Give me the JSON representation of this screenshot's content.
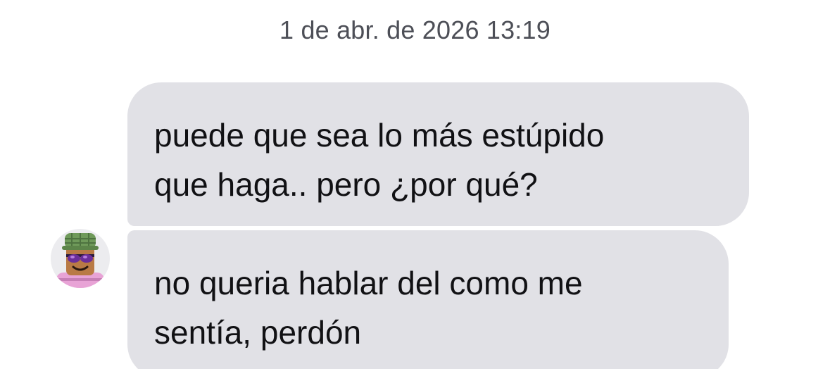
{
  "conversation": {
    "timestamp": "1 de abr. de 2026 13:19",
    "messages": [
      {
        "sender": "other",
        "lines": [
          "puede que sea lo más estúpido",
          "que haga.. pero ¿por qué?"
        ]
      },
      {
        "sender": "other",
        "lines": [
          "no queria hablar del como me",
          "sentía, perdón"
        ]
      }
    ],
    "avatar_icon": "roblox-avatar-icon",
    "colors": {
      "bubble_background": "#e1e1e6",
      "message_text": "#111114",
      "timestamp_text": "#4d4f57",
      "page_background": "#ffffff"
    }
  }
}
